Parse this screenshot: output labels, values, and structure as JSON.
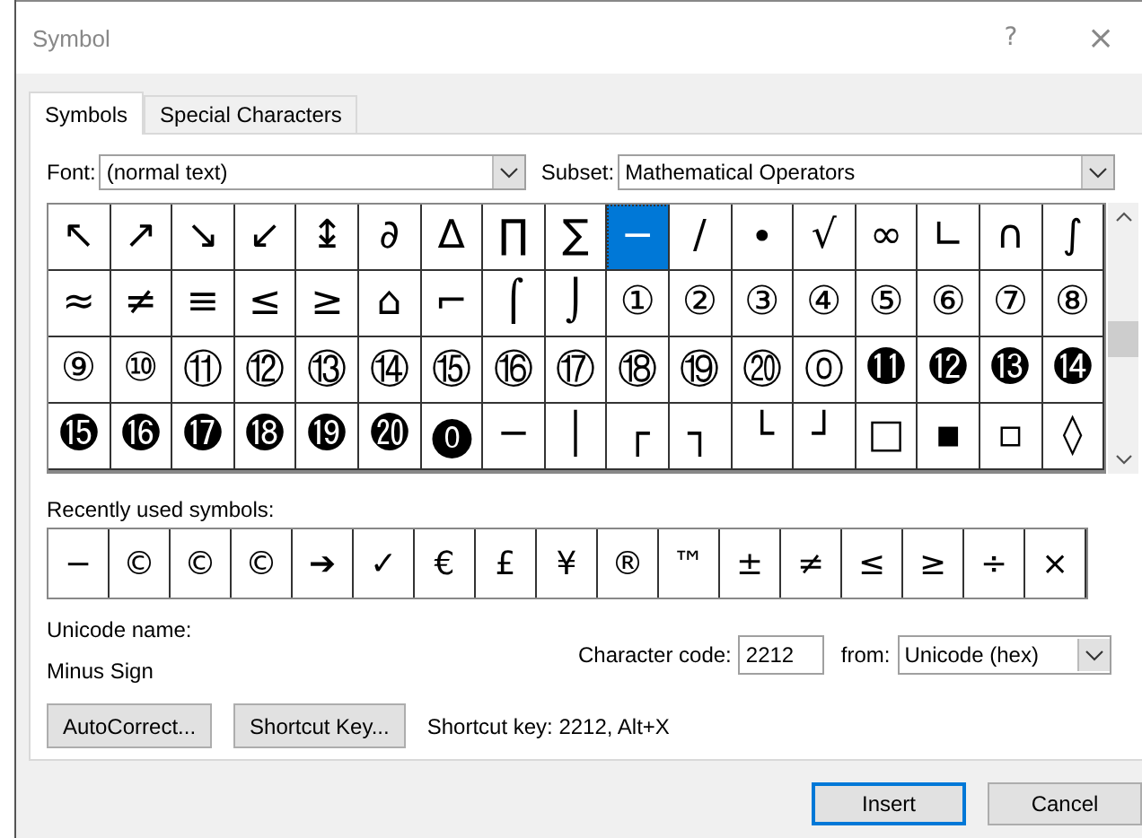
{
  "window": {
    "title": "Symbol",
    "help": "?",
    "close": "×"
  },
  "tabs": [
    {
      "label": "Symbols",
      "selected": true
    },
    {
      "label": "Special Characters",
      "selected": false
    }
  ],
  "font": {
    "label": "Font:",
    "value": "(normal text)"
  },
  "subset": {
    "label": "Subset:",
    "value": "Mathematical Operators"
  },
  "symbols": [
    [
      {
        "char": "↖",
        "selected": false
      },
      {
        "char": "↗",
        "selected": false
      },
      {
        "char": "↘",
        "selected": false
      },
      {
        "char": "↙",
        "selected": false
      },
      {
        "char": "↨",
        "selected": false
      },
      {
        "char": "∂",
        "selected": false
      },
      {
        "char": "∆",
        "selected": false
      },
      {
        "char": "∏",
        "selected": false
      },
      {
        "char": "∑",
        "selected": false
      },
      {
        "char": "−",
        "selected": true
      },
      {
        "char": "∕",
        "selected": false
      },
      {
        "char": "∙",
        "selected": false
      },
      {
        "char": "√",
        "selected": false
      },
      {
        "char": "∞",
        "selected": false
      },
      {
        "char": "∟",
        "selected": false
      },
      {
        "char": "∩",
        "selected": false
      },
      {
        "char": "∫",
        "selected": false
      }
    ],
    [
      {
        "char": "≈",
        "selected": false
      },
      {
        "char": "≠",
        "selected": false
      },
      {
        "char": "≡",
        "selected": false
      },
      {
        "char": "≤",
        "selected": false
      },
      {
        "char": "≥",
        "selected": false
      },
      {
        "char": "⌂",
        "selected": false
      },
      {
        "char": "⌐",
        "selected": false
      },
      {
        "char": "⌠",
        "selected": false
      },
      {
        "char": "⌡",
        "selected": false
      },
      {
        "char": "①",
        "selected": false
      },
      {
        "char": "②",
        "selected": false
      },
      {
        "char": "③",
        "selected": false
      },
      {
        "char": "④",
        "selected": false
      },
      {
        "char": "⑤",
        "selected": false
      },
      {
        "char": "⑥",
        "selected": false
      },
      {
        "char": "⑦",
        "selected": false
      },
      {
        "char": "⑧",
        "selected": false
      }
    ],
    [
      {
        "char": "⑨",
        "selected": false
      },
      {
        "char": "⑩",
        "selected": false
      },
      {
        "char": "⑪",
        "selected": false
      },
      {
        "char": "⑫",
        "selected": false
      },
      {
        "char": "⑬",
        "selected": false
      },
      {
        "char": "⑭",
        "selected": false
      },
      {
        "char": "⑮",
        "selected": false
      },
      {
        "char": "⑯",
        "selected": false
      },
      {
        "char": "⑰",
        "selected": false
      },
      {
        "char": "⑱",
        "selected": false
      },
      {
        "char": "⑲",
        "selected": false
      },
      {
        "char": "⑳",
        "selected": false
      },
      {
        "char": "⓪",
        "selected": false
      },
      {
        "char": "⓫",
        "selected": false
      },
      {
        "char": "⓬",
        "selected": false
      },
      {
        "char": "⓭",
        "selected": false
      },
      {
        "char": "⓮",
        "selected": false
      }
    ],
    [
      {
        "char": "⓯",
        "selected": false
      },
      {
        "char": "⓰",
        "selected": false
      },
      {
        "char": "⓱",
        "selected": false
      },
      {
        "char": "⓲",
        "selected": false
      },
      {
        "char": "⓳",
        "selected": false
      },
      {
        "char": "⓴",
        "selected": false
      },
      {
        "char": "⓿",
        "selected": false
      },
      {
        "char": "─",
        "selected": false
      },
      {
        "char": "│",
        "selected": false
      },
      {
        "char": "┌",
        "selected": false
      },
      {
        "char": "┐",
        "selected": false
      },
      {
        "char": "└",
        "selected": false
      },
      {
        "char": "┘",
        "selected": false
      },
      {
        "char": "□",
        "selected": false
      },
      {
        "char": "▪",
        "selected": false
      },
      {
        "char": "▫",
        "selected": false
      },
      {
        "char": "◊",
        "selected": false
      }
    ]
  ],
  "recent": {
    "label": "Recently used symbols:",
    "symbols": [
      "−",
      "©",
      "©",
      "©",
      "➔",
      "✓",
      "€",
      "£",
      "¥",
      "®",
      "™",
      "±",
      "≠",
      "≤",
      "≥",
      "÷",
      "×"
    ]
  },
  "unicode_name": {
    "label": "Unicode name:",
    "value": "Minus Sign"
  },
  "character_code": {
    "label": "Character code:",
    "value": "2212"
  },
  "from": {
    "label": "from:",
    "value": "Unicode (hex)"
  },
  "buttons": [
    {
      "label": "AutoCorrect..."
    },
    {
      "label": "Shortcut Key..."
    }
  ],
  "shortcut_text": "Shortcut key: 2212, Alt+X",
  "footer_buttons": [
    {
      "label": "Insert",
      "default": true
    },
    {
      "label": "Cancel",
      "default": false
    }
  ]
}
